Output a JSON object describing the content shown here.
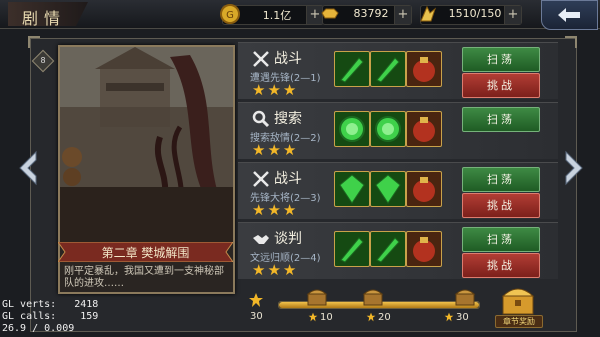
{
  "header": {
    "title": "剧情",
    "resources": [
      {
        "icon": "coin-icon",
        "value": "1.1亿"
      },
      {
        "icon": "gold-ingot-icon",
        "value": "83792"
      },
      {
        "icon": "stamina-icon",
        "value": "1510/150"
      }
    ],
    "back_icon": "back-arrow-icon"
  },
  "chapter": {
    "badge": "8",
    "title": "第二章  樊城解围",
    "description": "刚平定暴乱，我国又遭到一支神秘部队的进攻……"
  },
  "stages": [
    {
      "type": "战斗",
      "icon": "crossed-swords-icon",
      "subtitle": "遭遇先锋(2—1)",
      "stars": 3,
      "rewards": [
        "green-blade-item-icon",
        "green-blade-item-icon",
        "red-pouch-item-icon"
      ],
      "buttons": {
        "sweep": "扫荡",
        "challenge": "挑战"
      }
    },
    {
      "type": "搜索",
      "icon": "magnifier-icon",
      "subtitle": "搜索敌情(2—2)",
      "stars": 3,
      "rewards": [
        "green-orb-item-icon",
        "green-orb-item-icon",
        "red-pouch-item-icon"
      ],
      "buttons": {
        "sweep": "扫荡",
        "challenge": ""
      }
    },
    {
      "type": "战斗",
      "icon": "crossed-swords-icon",
      "subtitle": "先锋大将(2—3)",
      "stars": 3,
      "rewards": [
        "green-gem-item-icon",
        "green-gem-item-icon",
        "red-pouch-item-icon"
      ],
      "buttons": {
        "sweep": "扫荡",
        "challenge": "挑战"
      }
    },
    {
      "type": "谈判",
      "icon": "handshake-icon",
      "subtitle": "文远归顺(2—4)",
      "stars": 3,
      "rewards": [
        "green-blade-item-icon",
        "green-blade-item-icon",
        "red-pouch-item-icon"
      ],
      "buttons": {
        "sweep": "扫荡",
        "challenge": "挑战"
      }
    }
  ],
  "progress": {
    "star_count": "30",
    "fraction": 1.0,
    "milestones": [
      "10",
      "20",
      "30"
    ],
    "reward_label": "章节奖励"
  },
  "debug": {
    "line1": "GL verts:   2418",
    "line2": "GL calls:    159",
    "line3": "26.9 / 0.009"
  },
  "colors": {
    "accent_gold": "#f2b728",
    "sweep_green": "#2e7a35",
    "challenge_red": "#a0322b"
  }
}
